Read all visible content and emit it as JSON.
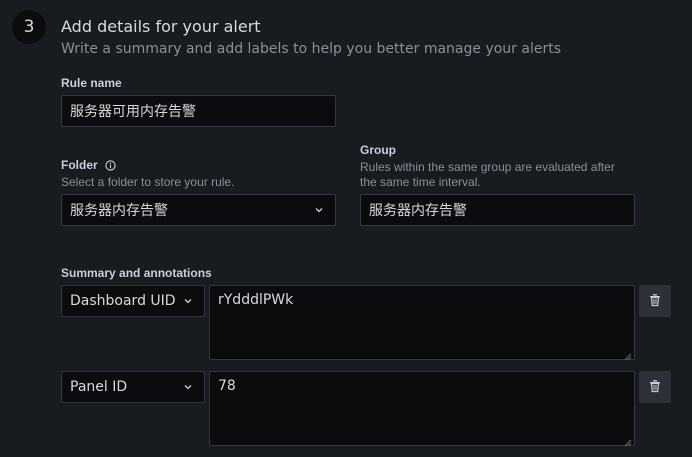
{
  "step": {
    "number": "3",
    "title": "Add details for your alert",
    "subtitle": "Write a summary and add labels to help you better manage your alerts"
  },
  "rule_name": {
    "label": "Rule name",
    "value": "服务器可用内存告警"
  },
  "folder": {
    "label": "Folder",
    "description": "Select a folder to store your rule.",
    "value": "服务器内存告警",
    "info_icon": "info-circle-icon"
  },
  "group": {
    "label": "Group",
    "description_line1": "Rules within the same group are evaluated after",
    "description_line2": "the same time interval.",
    "value": "服务器内存告警"
  },
  "annotations": {
    "label": "Summary and annotations",
    "rows": [
      {
        "key": "Dashboard UID",
        "value": "rYdddlPWk"
      },
      {
        "key": "Panel ID",
        "value": "78"
      }
    ]
  },
  "colors": {
    "background": "#181b1f",
    "input_bg": "#0b0c0e",
    "border": "#34373f"
  }
}
